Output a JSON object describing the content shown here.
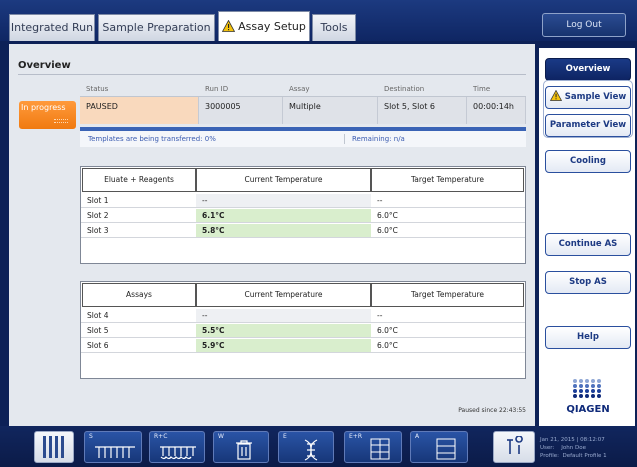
{
  "tabs": [
    {
      "label": "Integrated Run"
    },
    {
      "label": "Sample Preparation"
    },
    {
      "label": "Assay Setup"
    },
    {
      "label": "Tools"
    }
  ],
  "logout_label": "Log Out",
  "overview": {
    "title": "Overview",
    "state_badge": "In progress",
    "headers": [
      "Status",
      "Run ID",
      "Assay",
      "Destination",
      "Time"
    ],
    "values": [
      "PAUSED",
      "3000005",
      "Multiple",
      "Slot 5, Slot 6",
      "00:00:14h"
    ],
    "transfer_text": "Templates are being transferred: 0%",
    "remaining_text": "Remaining: n/a"
  },
  "eluate_table": {
    "headers": [
      "Eluate + Reagents",
      "Current Temperature",
      "Target Temperature"
    ],
    "rows": [
      {
        "slot": "Slot 1",
        "current": "--",
        "target": "--",
        "ok": false
      },
      {
        "slot": "Slot 2",
        "current": "6.1°C",
        "target": "6.0°C",
        "ok": true
      },
      {
        "slot": "Slot 3",
        "current": "5.8°C",
        "target": "6.0°C",
        "ok": true
      }
    ]
  },
  "assay_table": {
    "headers": [
      "Assays",
      "Current Temperature",
      "Target Temperature"
    ],
    "rows": [
      {
        "slot": "Slot 4",
        "current": "--",
        "target": "--",
        "ok": false
      },
      {
        "slot": "Slot 5",
        "current": "5.5°C",
        "target": "6.0°C",
        "ok": true
      },
      {
        "slot": "Slot 6",
        "current": "5.9°C",
        "target": "6.0°C",
        "ok": true
      }
    ]
  },
  "paused_since": "Paused since 22:43:55",
  "right_panel": {
    "overview": "Overview",
    "sample_view": "Sample View",
    "parameter_view": "Parameter View",
    "cooling": "Cooling",
    "continue": "Continue AS",
    "stop": "Stop AS",
    "help": "Help",
    "logo_text": "QIAGEN"
  },
  "bottom_buttons": [
    {
      "label": "",
      "icon": "rack-icon"
    },
    {
      "label": "S",
      "icon": "sample-tubes-icon"
    },
    {
      "label": "R+C",
      "icon": "reagent-cartridge-icon"
    },
    {
      "label": "W",
      "icon": "waste-icon"
    },
    {
      "label": "E",
      "icon": "dna-icon"
    },
    {
      "label": "E+R",
      "icon": "plate-grid-icon"
    },
    {
      "label": "A",
      "icon": "assay-plate-icon"
    },
    {
      "label": "",
      "icon": "tools-icon"
    }
  ],
  "user_info": {
    "datetime": "Jan 21, 2015 | 08:12:07",
    "user_label": "User:",
    "user": "John Doe",
    "profile_label": "Profile:",
    "profile": "Default Profile 1"
  },
  "colors": {
    "navy": "#0d2157",
    "accent_orange": "#f07a10",
    "temp_ok_green": "#d9eecd",
    "paused_peach": "#f9d9bd"
  }
}
